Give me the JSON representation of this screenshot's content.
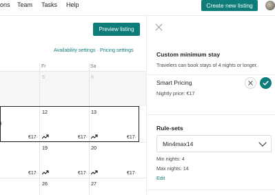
{
  "nav": {
    "items": [
      "ons",
      "Team",
      "Tasks",
      "Help"
    ],
    "create_button": "Create new listing"
  },
  "toolbar": {
    "preview_button": "Preview listing",
    "availability_link": "Availability settings",
    "separator": "·",
    "pricing_link": "Pricing settings"
  },
  "calendar": {
    "day_headers": [
      "Fr",
      "Sa"
    ],
    "rows": [
      {
        "cells": [
          {
            "date": "5",
            "price": ""
          },
          {
            "date": "6",
            "price": ""
          }
        ]
      },
      {
        "cells": [
          {
            "date": "12",
            "price": "€17·"
          },
          {
            "date": "13",
            "price": "€17·"
          }
        ],
        "left_price": "€17·"
      },
      {
        "cells": [
          {
            "date": "19",
            "price": "€17·"
          },
          {
            "date": "20",
            "price": "€17·"
          }
        ],
        "left_price": "€17·"
      },
      {
        "cells": [
          {
            "date": "26",
            "price": ""
          },
          {
            "date": "27",
            "price": ""
          }
        ]
      }
    ],
    "left_fragment": ")"
  },
  "panel": {
    "min_stay_title": "Custom minimum stay",
    "min_stay_text": "Travelers can book stays of 4 nights or longer.",
    "smart_pricing_title": "Smart Pricing",
    "smart_pricing_text": "Nightly price: €17",
    "rulesets_title": "Rule-sets",
    "ruleset_selected": "Min4max14",
    "min_nights": "Min nights: 4",
    "max_nights": "Max nights: 14",
    "edit_link": "Edit"
  },
  "colors": {
    "brand": "#0e7c79",
    "border": "#ebebeb",
    "muted_text": "#767676"
  },
  "icons": {
    "close": "close-icon",
    "decline": "x-icon",
    "accept": "check-icon",
    "trend": "trend-icon",
    "dropdown": "chevron-down-icon"
  }
}
